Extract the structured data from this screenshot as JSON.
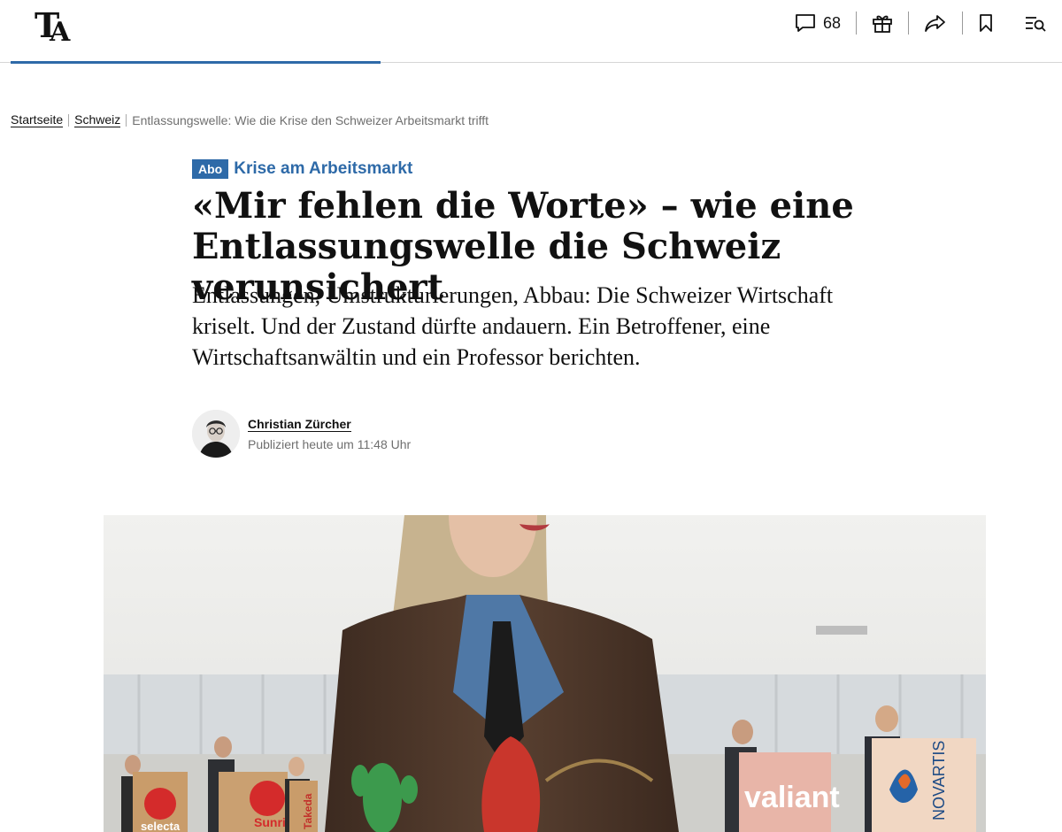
{
  "header": {
    "logo_text": "TA",
    "comments_count": "68",
    "icons": [
      "comment-icon",
      "gift-icon",
      "share-icon",
      "bookmark-icon",
      "menu-search-icon"
    ]
  },
  "breadcrumb": {
    "home": "Startseite",
    "section": "Schweiz",
    "current": "Entlassungswelle: Wie die Krise den Schweizer Arbeitsmarkt trifft"
  },
  "article": {
    "badge": "Abo",
    "kicker": "Krise am Arbeitsmarkt",
    "headline": "«Mir fehlen die Worte» – wie eine Entlassungswelle die Schweiz verunsichert",
    "lead": "Entlassungen, Umstrukturierungen, Abbau: Die Schweizer Wirtschaft kriselt. Und der Zustand dürfte andauern. Ein Betroffener, eine Wirtschaftsanwältin und ein Professor berichten.",
    "author": "Christian Zürcher",
    "published": "Publiziert heute um 11:48 Uhr"
  },
  "hero": {
    "box_labels": [
      "selecta",
      "Sunri",
      "Takeda",
      "valiant",
      "NOVARTIS"
    ]
  },
  "colors": {
    "accent": "#2e6aa8",
    "text": "#111111",
    "muted": "#6f6f6f"
  }
}
